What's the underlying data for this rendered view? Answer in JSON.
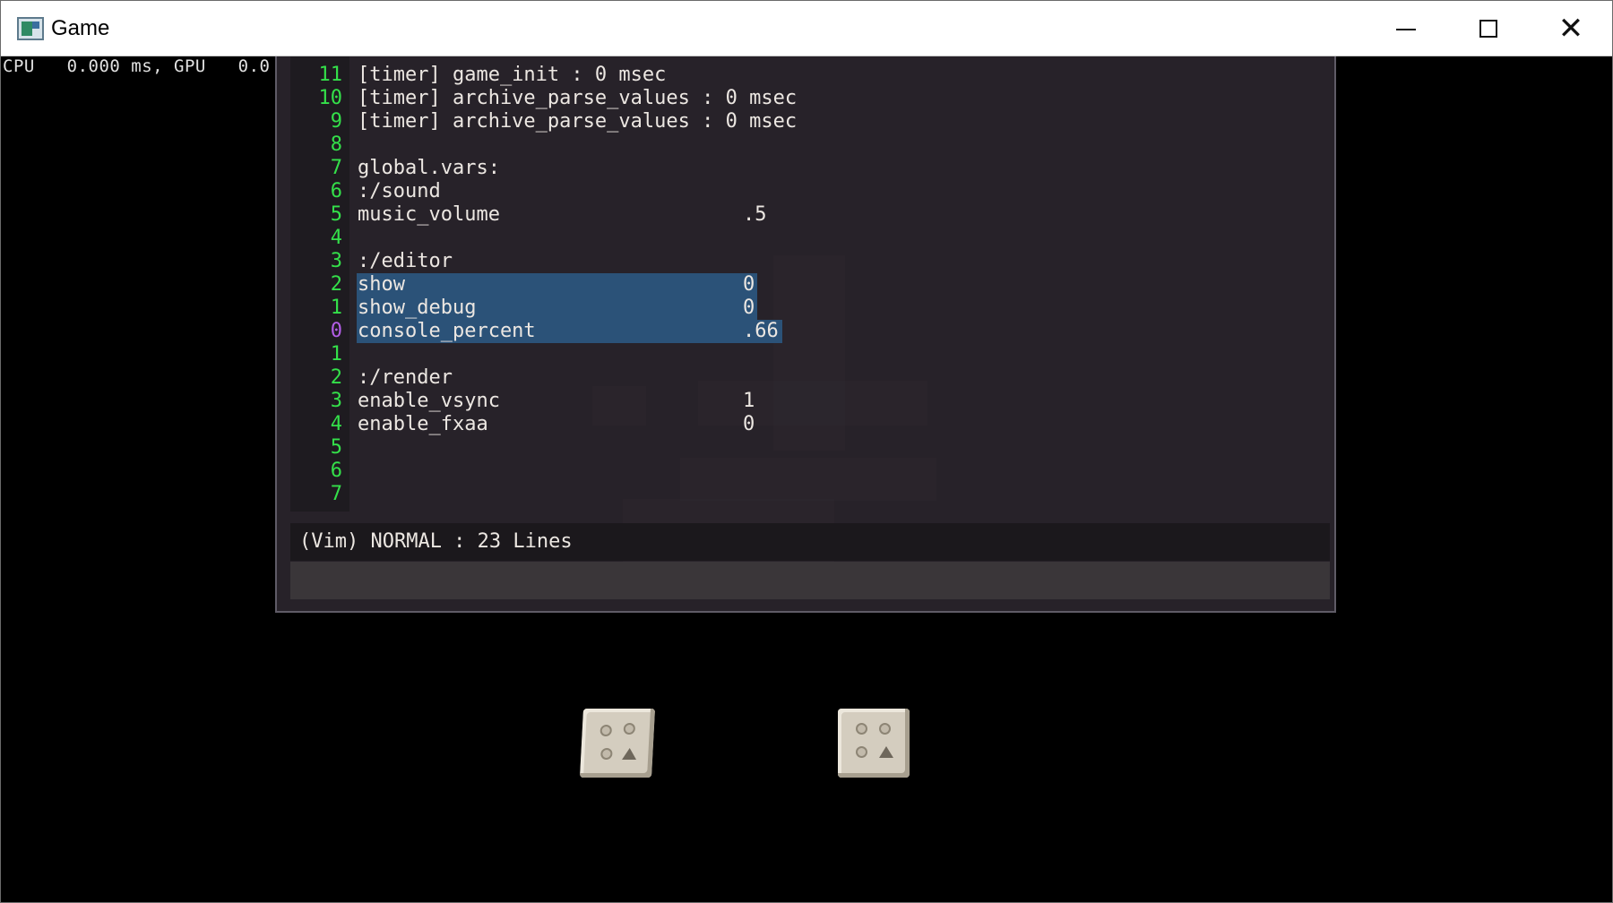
{
  "window": {
    "title": "Game",
    "icon": "app-window-icon",
    "controls": {
      "minimize": "minimize-icon",
      "maximize": "maximize-icon",
      "close": "✕"
    }
  },
  "perf_overlay": {
    "text": "CPU   0.000 ms, GPU   0.0"
  },
  "console": {
    "lines": [
      {
        "num": "11",
        "text": "[timer] game_init : 0 msec",
        "value": ""
      },
      {
        "num": "10",
        "text": "[timer] archive_parse_values : 0 msec",
        "value": ""
      },
      {
        "num": "9",
        "text": "[timer] archive_parse_values : 0 msec",
        "value": ""
      },
      {
        "num": "8",
        "text": "",
        "value": ""
      },
      {
        "num": "7",
        "text": "global.vars:",
        "value": ""
      },
      {
        "num": "6",
        "text": ":/sound",
        "value": ""
      },
      {
        "num": "5",
        "text": "music_volume",
        "value": ".5"
      },
      {
        "num": "4",
        "text": "",
        "value": ""
      },
      {
        "num": "3",
        "text": ":/editor",
        "value": ""
      },
      {
        "num": "2",
        "text": "show",
        "value": "0"
      },
      {
        "num": "1",
        "text": "show_debug",
        "value": "0"
      },
      {
        "num": "0",
        "text": "console_percent",
        "value": ".66"
      },
      {
        "num": "1",
        "text": "",
        "value": ""
      },
      {
        "num": "2",
        "text": ":/render",
        "value": ""
      },
      {
        "num": "3",
        "text": "enable_vsync",
        "value": "1"
      },
      {
        "num": "4",
        "text": "enable_fxaa",
        "value": "0"
      },
      {
        "num": "5",
        "text": "",
        "value": ""
      },
      {
        "num": "6",
        "text": "",
        "value": ""
      },
      {
        "num": "7",
        "text": "",
        "value": ""
      }
    ],
    "status": "(Vim) NORMAL : 23 Lines",
    "command_line": "",
    "colors": {
      "line_number": "#34e04a",
      "current_line_number": "#b45ee8",
      "selection": "#2b5278"
    }
  }
}
